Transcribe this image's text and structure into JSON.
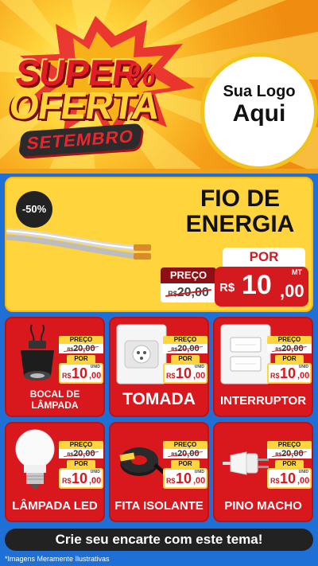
{
  "hero": {
    "super": "SUPER",
    "oferta": "OFERTA",
    "month": "SETEMBRO",
    "percent": "%",
    "logo_line1": "Sua Logo",
    "logo_line2": "Aqui"
  },
  "feature": {
    "discount": "-50%",
    "title_line1": "FIO DE",
    "title_line2": "ENERGIA",
    "por": "POR",
    "preco_label": "PREÇO",
    "old_currency": "R$",
    "old_price": "20,00",
    "currency": "R$",
    "price_int": "10",
    "price_cents": ",00",
    "unit": "MT"
  },
  "products": [
    {
      "name_line1": "BOCAL DE",
      "name_line2": "LÂMPADA",
      "preco_label": "PREÇO",
      "old_currency": "R$",
      "old_price": "20,00",
      "por": "POR",
      "currency": "R$",
      "price_int": "10",
      "price_cents": ",00",
      "unit": "UNID",
      "icon": "lamp-socket-icon"
    },
    {
      "name": "TOMADA",
      "preco_label": "PREÇO",
      "old_currency": "R$",
      "old_price": "20,00",
      "por": "POR",
      "currency": "R$",
      "price_int": "10",
      "price_cents": ",00",
      "unit": "UNID",
      "icon": "wall-outlet-icon"
    },
    {
      "name": "INTERRUPTOR",
      "preco_label": "PREÇO",
      "old_currency": "R$",
      "old_price": "20,00",
      "por": "POR",
      "currency": "R$",
      "price_int": "10",
      "price_cents": ",00",
      "unit": "UNID",
      "icon": "light-switch-icon"
    },
    {
      "name": "LÂMPADA LED",
      "preco_label": "PREÇO",
      "old_currency": "R$",
      "old_price": "20,00",
      "por": "POR",
      "currency": "R$",
      "price_int": "10",
      "price_cents": ",00",
      "unit": "UNID",
      "icon": "led-bulb-icon"
    },
    {
      "name": "FITA ISOLANTE",
      "preco_label": "PREÇO",
      "old_currency": "R$",
      "old_price": "20,00",
      "por": "POR",
      "currency": "R$",
      "price_int": "10",
      "price_cents": ",00",
      "unit": "UNID",
      "icon": "tape-roll-icon"
    },
    {
      "name": "PINO MACHO",
      "preco_label": "PREÇO",
      "old_currency": "R$",
      "old_price": "20,00",
      "por": "POR",
      "currency": "R$",
      "price_int": "10",
      "price_cents": ",00",
      "unit": "UNID",
      "icon": "plug-icon"
    }
  ],
  "cta": "Crie seu encarte com este tema!",
  "footnote": "*Imagens Meramente Ilustrativas",
  "colors": {
    "red": "#d9181e",
    "yellow": "#ffd43c",
    "blue": "#1e6fd6",
    "dark": "#222222"
  }
}
